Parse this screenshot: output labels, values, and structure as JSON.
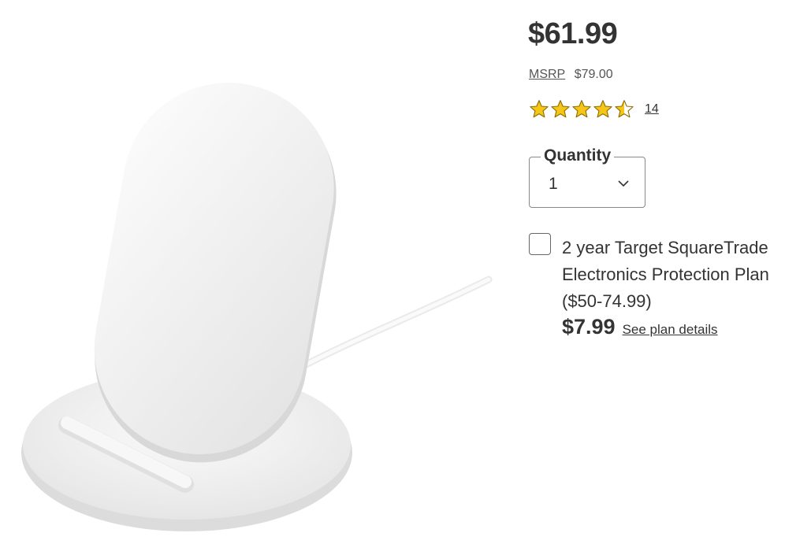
{
  "product": {
    "image_alt": "Wireless charging stand",
    "price": "$61.99",
    "msrp_label": "MSRP",
    "msrp_value": "$79.00",
    "rating": 4.5,
    "review_count": "14",
    "star_color": "#f5c518"
  },
  "quantity": {
    "label": "Quantity",
    "value": "1"
  },
  "protection_plan": {
    "checked": false,
    "line1": "2 year Target SquareTrade",
    "line2": "Electronics Protection Plan",
    "line3": "($50-74.99)",
    "price": "$7.99",
    "details_link": "See plan details"
  }
}
